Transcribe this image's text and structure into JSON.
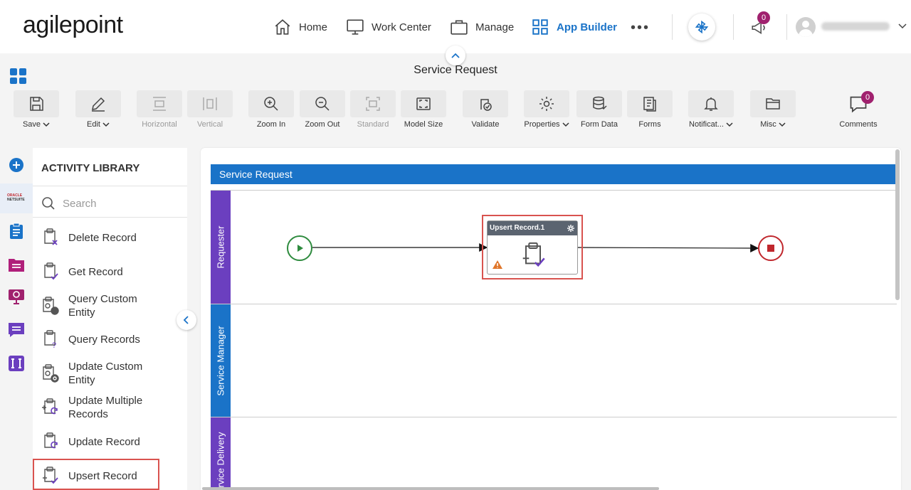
{
  "topnav": {
    "logo": "agilepoint",
    "items": [
      {
        "label": "Home",
        "icon": "home-icon"
      },
      {
        "label": "Work Center",
        "icon": "monitor-icon"
      },
      {
        "label": "Manage",
        "icon": "briefcase-icon"
      },
      {
        "label": "App Builder",
        "icon": "grid-icon",
        "active": true
      }
    ],
    "more_label": "•••",
    "notifications_count": "0"
  },
  "header": {
    "title": "Service Request"
  },
  "toolbar": {
    "save": "Save",
    "edit": "Edit",
    "horizontal": "Horizontal",
    "vertical": "Vertical",
    "zoom_in": "Zoom In",
    "zoom_out": "Zoom Out",
    "standard": "Standard",
    "model_size": "Model Size",
    "validate": "Validate",
    "properties": "Properties",
    "form_data": "Form Data",
    "forms": "Forms",
    "notifications": "Notificat...",
    "misc": "Misc",
    "comments": "Comments",
    "comments_count": "0"
  },
  "library": {
    "title": "ACTIVITY LIBRARY",
    "search_placeholder": "Search",
    "items": [
      "Delete Record",
      "Get Record",
      "Query Custom Entity",
      "Query Records",
      "Update Custom Entity",
      "Update Multiple Records",
      "Update Record",
      "Upsert Record"
    ]
  },
  "diagram": {
    "pool_title": "Service Request",
    "lanes": [
      "Requester",
      "Service Manager",
      "Service Delivery"
    ],
    "task_title": "Upsert Record.1"
  },
  "colors": {
    "brand_blue": "#1a73c8",
    "lane_purple": "#6b3fbf",
    "highlight_red": "#d9534f",
    "start_green": "#2e8b3e",
    "end_red": "#c0272d"
  }
}
